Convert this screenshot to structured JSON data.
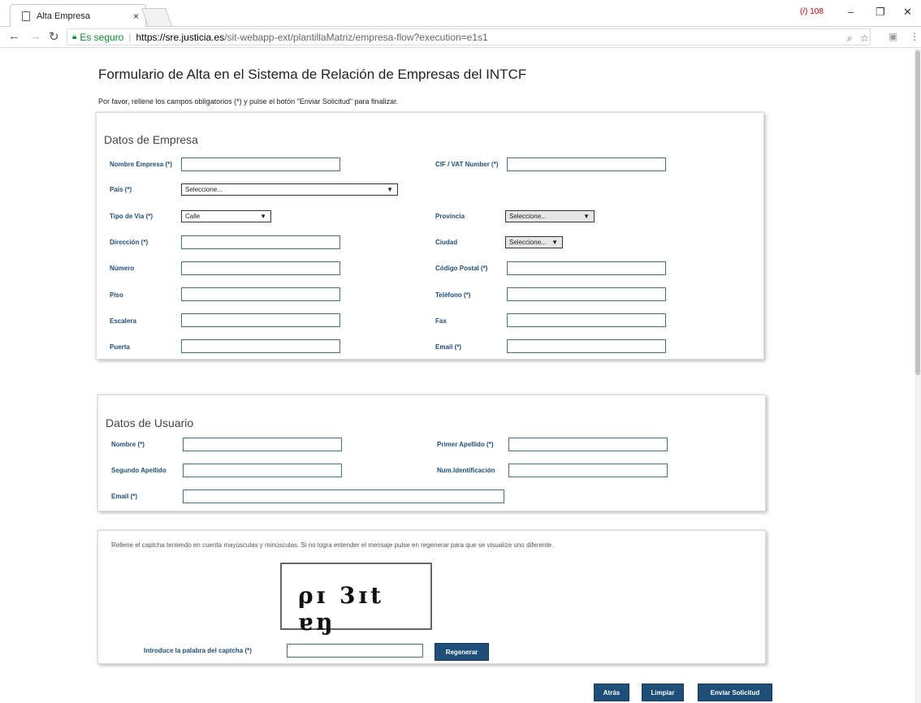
{
  "browser": {
    "tab_title": "Alta Empresa",
    "tab_close": "×",
    "secure_label": "Es seguro",
    "url_host": "https://sre.justicia.es",
    "url_path": "/sit-webapp-ext/plantillaMatriz/empresa-flow?execution=e1s1",
    "ext_label": "(/) 108",
    "icons": [
      "back-icon",
      "forward-icon",
      "reload-icon",
      "lock-icon",
      "zoom-icon",
      "star-icon",
      "menu-icon"
    ]
  },
  "page": {
    "title": "Formulario de Alta en el Sistema de Relación de Empresas del INTCF",
    "intro": "Por favor, rellene los campos obligatorios (*) y pulse el botón \"Enviar Solicitud\" para finalizar."
  },
  "empresa": {
    "section_title": "Datos de Empresa",
    "nombre_label": "Nombre Empresa (*)",
    "cif_label": "CIF / VAT Number (*)",
    "pais_label": "País (*)",
    "pais_value": "Seleccione...",
    "tipo_via_label": "Tipo de Via (*)",
    "tipo_via_value": "Calle",
    "provincia_label": "Provincia",
    "provincia_value": "Seleccione...",
    "direccion_label": "Dirección (*)",
    "ciudad_label": "Ciudad",
    "ciudad_value": "Seleccione...",
    "numero_label": "Número",
    "cp_label": "Código Postal (*)",
    "piso_label": "Piso",
    "telefono_label": "Teléfono (*)",
    "escalera_label": "Escalera",
    "fax_label": "Fax",
    "puerta_label": "Puerta",
    "email_label": "Email (*)"
  },
  "usuario": {
    "section_title": "Datos de Usuario",
    "nombre_label": "Nombre (*)",
    "primer_apellido_label": "Primer Apellido (*)",
    "segundo_apellido_label": "Segundo Apellido",
    "num_id_label": "Num.Identificación",
    "email_label": "Email (*)"
  },
  "captcha": {
    "instructions": "Rellene el captcha teniendo en cuenta mayúsculas y minúsculas. Si no logra entender el mensaje pulse en regenerar para que se visualize uno diferente.",
    "image_text": "ρɪ 3ɪt ɐŋ",
    "input_label": "Introduce la palabra del captcha (*)",
    "regenerate_label": "Regenerar"
  },
  "actions": {
    "back_label": "Atrás",
    "clear_label": "Limpiar",
    "submit_label": "Enviar Solicitud"
  },
  "colors": {
    "label_blue": "#1f4e79",
    "button_blue": "#1f4e79",
    "secure_green": "#0a8a2e"
  }
}
